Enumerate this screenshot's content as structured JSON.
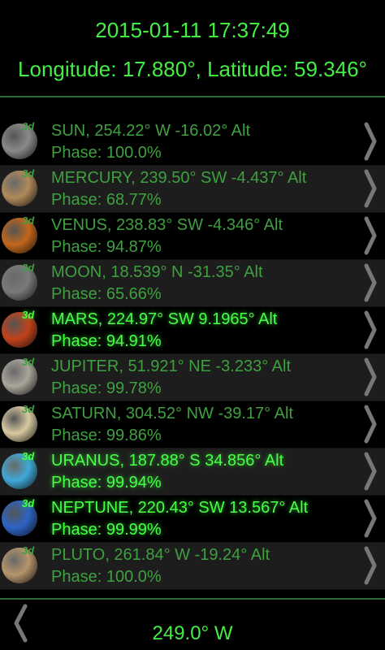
{
  "header": {
    "datetime": "2015-01-11 17:37:49",
    "location": "Longitude: 17.880°, Latitude: 59.346°"
  },
  "bodies": [
    {
      "name": "SUN",
      "info": "SUN, 254.22° W -16.02° Alt",
      "phase": "Phase: 100.0%",
      "visible": false,
      "icon": "sun-icon",
      "color": "#8a8a8a"
    },
    {
      "name": "MERCURY",
      "info": "MERCURY, 239.50° SW -4.437° Alt",
      "phase": "Phase: 68.77%",
      "visible": false,
      "icon": "mercury-icon",
      "color": "#b08a5a"
    },
    {
      "name": "VENUS",
      "info": "VENUS, 238.83° SW -4.346° Alt",
      "phase": "Phase: 94.87%",
      "visible": false,
      "icon": "venus-icon",
      "color": "#c2661a"
    },
    {
      "name": "MOON",
      "info": "MOON, 18.539° N -31.35° Alt",
      "phase": "Phase: 65.66%",
      "visible": false,
      "icon": "moon-icon",
      "color": "#7a7a7a"
    },
    {
      "name": "MARS",
      "info": "MARS, 224.97° SW 9.1965° Alt",
      "phase": "Phase: 94.91%",
      "visible": true,
      "icon": "mars-icon",
      "color": "#c2411a"
    },
    {
      "name": "JUPITER",
      "info": "JUPITER, 51.921° NE -3.233° Alt",
      "phase": "Phase: 99.78%",
      "visible": false,
      "icon": "jupiter-icon",
      "color": "#a9a59a"
    },
    {
      "name": "SATURN",
      "info": "SATURN, 304.52° NW -39.17° Alt",
      "phase": "Phase: 99.86%",
      "visible": false,
      "icon": "saturn-icon",
      "color": "#d8c9a0"
    },
    {
      "name": "URANUS",
      "info": "URANUS, 187.88° S 34.856° Alt",
      "phase": "Phase: 99.94%",
      "visible": true,
      "icon": "uranus-icon",
      "color": "#3fa9d8"
    },
    {
      "name": "NEPTUNE",
      "info": "NEPTUNE, 220.43° SW 13.567° Alt",
      "phase": "Phase: 99.99%",
      "visible": true,
      "icon": "neptune-icon",
      "color": "#2c63c4"
    },
    {
      "name": "PLUTO",
      "info": "PLUTO, 261.84° W -19.24° Alt",
      "phase": "Phase: 100.0%",
      "visible": false,
      "icon": "pluto-icon",
      "color": "#b6956a"
    }
  ],
  "tag_3d": "3d",
  "footer": {
    "azimuth": "249.0° W"
  },
  "colors": {
    "bright_green": "#47ff47",
    "dim_green": "#3fa03f",
    "separator": "#2f6a3a"
  }
}
